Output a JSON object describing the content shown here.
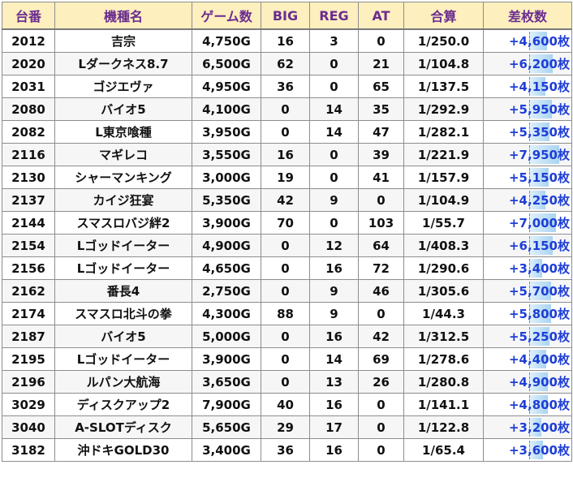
{
  "headers": {
    "unit": "台番",
    "model": "機種名",
    "games": "ゲーム数",
    "big": "BIG",
    "reg": "REG",
    "at": "AT",
    "total": "合算",
    "diff": "差枚数"
  },
  "colors": {
    "header_bg": "#fdefbe",
    "header_text": "#6a2d8f",
    "diff_text": "#1e3ed6",
    "diff_bar": "#a9d4f2"
  },
  "rows": [
    {
      "unit": "2012",
      "model": "吉宗",
      "games": "4,750G",
      "big": "16",
      "reg": "3",
      "at": "0",
      "total": "1/250.0",
      "diff": "+4,600枚",
      "diff_value": 4600
    },
    {
      "unit": "2020",
      "model": "Lダークネス8.7",
      "games": "6,500G",
      "big": "62",
      "reg": "0",
      "at": "21",
      "total": "1/104.8",
      "diff": "+6,200枚",
      "diff_value": 6200
    },
    {
      "unit": "2031",
      "model": "ゴジエヴァ",
      "games": "4,950G",
      "big": "36",
      "reg": "0",
      "at": "65",
      "total": "1/137.5",
      "diff": "+4,150枚",
      "diff_value": 4150
    },
    {
      "unit": "2080",
      "model": "バイオ5",
      "games": "4,100G",
      "big": "0",
      "reg": "14",
      "at": "35",
      "total": "1/292.9",
      "diff": "+5,950枚",
      "diff_value": 5950
    },
    {
      "unit": "2082",
      "model": "L東京喰種",
      "games": "3,950G",
      "big": "0",
      "reg": "14",
      "at": "47",
      "total": "1/282.1",
      "diff": "+5,350枚",
      "diff_value": 5350
    },
    {
      "unit": "2116",
      "model": "マギレコ",
      "games": "3,550G",
      "big": "16",
      "reg": "0",
      "at": "39",
      "total": "1/221.9",
      "diff": "+7,950枚",
      "diff_value": 7950
    },
    {
      "unit": "2130",
      "model": "シャーマンキング",
      "games": "3,000G",
      "big": "19",
      "reg": "0",
      "at": "41",
      "total": "1/157.9",
      "diff": "+5,150枚",
      "diff_value": 5150
    },
    {
      "unit": "2137",
      "model": "カイジ狂宴",
      "games": "5,350G",
      "big": "42",
      "reg": "9",
      "at": "0",
      "total": "1/104.9",
      "diff": "+4,250枚",
      "diff_value": 4250
    },
    {
      "unit": "2144",
      "model": "スマスロバジ絆2",
      "games": "3,900G",
      "big": "70",
      "reg": "0",
      "at": "103",
      "total": "1/55.7",
      "diff": "+7,000枚",
      "diff_value": 7000
    },
    {
      "unit": "2154",
      "model": "Lゴッドイーター",
      "games": "4,900G",
      "big": "0",
      "reg": "12",
      "at": "64",
      "total": "1/408.3",
      "diff": "+6,150枚",
      "diff_value": 6150
    },
    {
      "unit": "2156",
      "model": "Lゴッドイーター",
      "games": "4,650G",
      "big": "0",
      "reg": "16",
      "at": "72",
      "total": "1/290.6",
      "diff": "+3,400枚",
      "diff_value": 3400
    },
    {
      "unit": "2162",
      "model": "番長4",
      "games": "2,750G",
      "big": "0",
      "reg": "9",
      "at": "46",
      "total": "1/305.6",
      "diff": "+5,700枚",
      "diff_value": 5700
    },
    {
      "unit": "2174",
      "model": "スマスロ北斗の拳",
      "games": "4,300G",
      "big": "88",
      "reg": "9",
      "at": "0",
      "total": "1/44.3",
      "diff": "+5,800枚",
      "diff_value": 5800
    },
    {
      "unit": "2187",
      "model": "バイオ5",
      "games": "5,000G",
      "big": "0",
      "reg": "16",
      "at": "42",
      "total": "1/312.5",
      "diff": "+5,250枚",
      "diff_value": 5250
    },
    {
      "unit": "2195",
      "model": "Lゴッドイーター",
      "games": "3,900G",
      "big": "0",
      "reg": "14",
      "at": "69",
      "total": "1/278.6",
      "diff": "+4,400枚",
      "diff_value": 4400
    },
    {
      "unit": "2196",
      "model": "ルパン大航海",
      "games": "3,650G",
      "big": "0",
      "reg": "13",
      "at": "26",
      "total": "1/280.8",
      "diff": "+4,900枚",
      "diff_value": 4900
    },
    {
      "unit": "3029",
      "model": "ディスクアップ2",
      "games": "7,900G",
      "big": "40",
      "reg": "16",
      "at": "0",
      "total": "1/141.1",
      "diff": "+4,800枚",
      "diff_value": 4800
    },
    {
      "unit": "3040",
      "model": "A-SLOTディスク",
      "games": "5,650G",
      "big": "29",
      "reg": "17",
      "at": "0",
      "total": "1/122.8",
      "diff": "+3,200枚",
      "diff_value": 3200
    },
    {
      "unit": "3182",
      "model": "沖ドキGOLD30",
      "games": "3,400G",
      "big": "36",
      "reg": "16",
      "at": "0",
      "total": "1/65.4",
      "diff": "+3,600枚",
      "diff_value": 3600
    }
  ]
}
